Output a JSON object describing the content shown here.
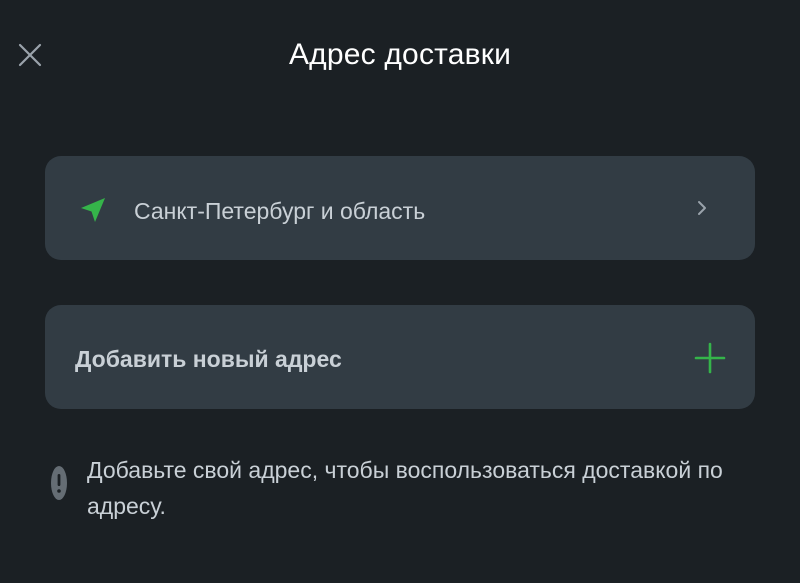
{
  "header": {
    "title": "Адрес доставки",
    "close_icon": "close-icon"
  },
  "region_card": {
    "icon": "location-arrow-icon",
    "label": "Санкт-Петербург и область",
    "chevron_icon": "chevron-right-icon"
  },
  "add_address_card": {
    "label": "Добавить новый адрес",
    "plus_icon": "plus-icon"
  },
  "info": {
    "icon": "exclamation-icon",
    "text": "Добавьте свой адрес, чтобы воспользоваться доставкой по адресу."
  },
  "colors": {
    "background": "#1b2024",
    "card": "#323c44",
    "accent": "#35b44a",
    "text": "#c9d0d6"
  }
}
